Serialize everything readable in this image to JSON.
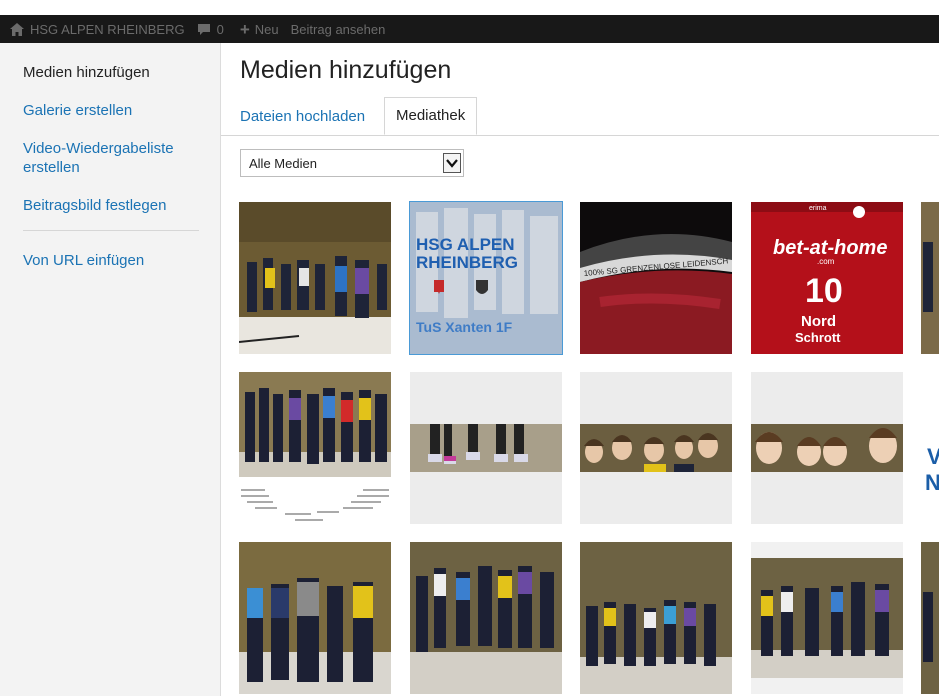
{
  "adminbar": {
    "site_name": "HSG ALPEN RHEINBERG",
    "comments_count": "0",
    "new_label": "Neu",
    "view_post_label": "Beitrag ansehen"
  },
  "sidebar": {
    "items": [
      {
        "label": "Medien hinzufügen"
      },
      {
        "label": "Galerie erstellen"
      },
      {
        "label": "Video-Wiedergabeliste erstellen"
      },
      {
        "label": "Beitragsbild festlegen"
      },
      {
        "label": "Von URL einfügen"
      }
    ]
  },
  "main": {
    "title": "Medien hinzufügen",
    "tabs": [
      {
        "label": "Dateien hochladen"
      },
      {
        "label": "Mediathek"
      }
    ],
    "filter": {
      "selected": "Alle Medien"
    }
  },
  "media": {
    "logo_line1": "HSG ALPEN",
    "logo_line2": "RHEINBERG",
    "logo_sub": "TuS Xanten 1F",
    "jersey_text": "100% SG GRENZENLOSE LEIDENSCH",
    "shirt_sponsor": "bet-at-home",
    "shirt_sponsor_sub": ".com",
    "shirt_number": "10",
    "shirt_back_1": "Nord",
    "shirt_back_2": "Schrott",
    "shirt_brand": "erima",
    "partial_text_1": "V",
    "partial_text_2": "N"
  },
  "colors": {
    "accent": "#1b73b4",
    "adminbar_bg": "#181818",
    "sidebar_bg": "#f3f3f3",
    "selected_border": "#4a9ad6"
  }
}
